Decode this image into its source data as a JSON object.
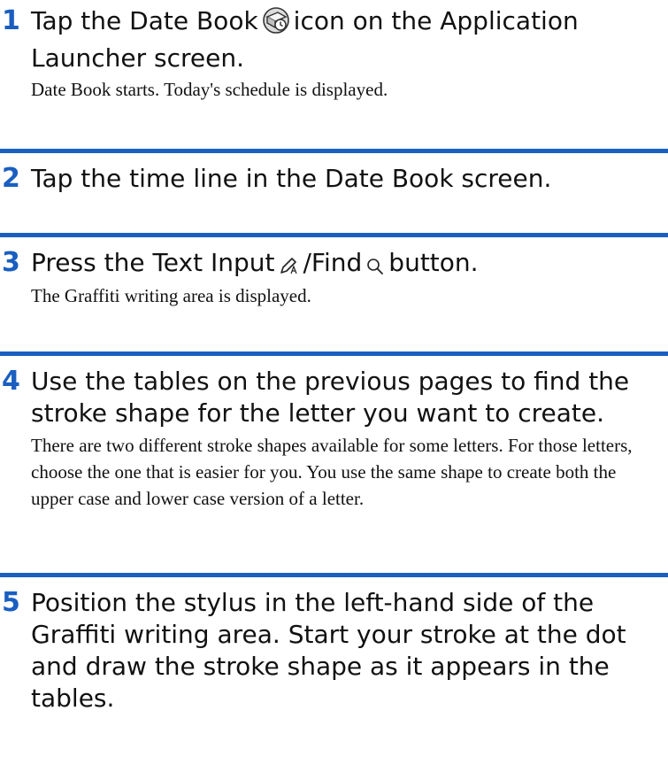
{
  "colors": {
    "accent": "#1a5fc0",
    "text": "#111111"
  },
  "steps": [
    {
      "number": "1",
      "heading_pre": "Tap the Date Book",
      "heading_post": "icon on the Application Launcher screen.",
      "icon": "date-book-icon",
      "body": "Date Book starts. Today's schedule is displayed."
    },
    {
      "number": "2",
      "heading": "Tap the time line in the Date Book screen."
    },
    {
      "number": "3",
      "heading_pre": "Press the Text Input",
      "heading_mid": "/Find",
      "heading_post": "button.",
      "icons": [
        "text-input-icon",
        "find-icon"
      ],
      "body": "The Graffiti writing area is displayed."
    },
    {
      "number": "4",
      "heading": "Use the tables on the previous pages to find the stroke shape for the letter you want to create.",
      "body": "There are two different stroke shapes available for some letters. For those letters, choose the one that is easier for you. You use the same shape to create both the upper case and lower case version of a letter."
    },
    {
      "number": "5",
      "heading": "Position the stylus in the left-hand side of the Graffiti writing area. Start your stroke at the dot and draw the stroke shape as it appears in the tables."
    }
  ]
}
